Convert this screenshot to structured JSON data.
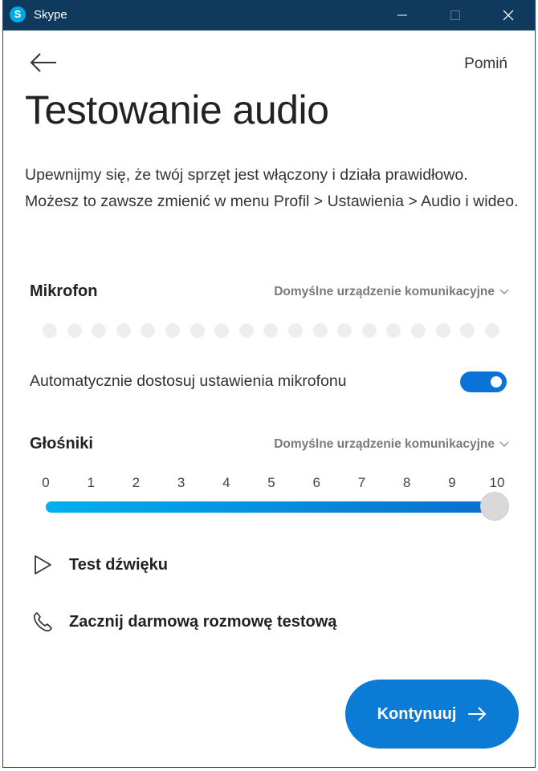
{
  "window": {
    "logo_letter": "S",
    "title": "Skype",
    "controls": [
      "minimize",
      "maximize",
      "close"
    ]
  },
  "nav": {
    "back_icon": "arrow-left-icon",
    "skip_label": "Pomiń"
  },
  "page": {
    "title": "Testowanie audio",
    "description": "Upewnijmy się, że twój sprzęt jest włączony i działa prawidłowo. Możesz to zawsze zmienić w menu Profil > Ustawienia > Audio i wideo."
  },
  "microphone": {
    "label": "Mikrofon",
    "device": "Domyślne urządzenie komunikacyjne",
    "level_dots_total": 19,
    "level_dots_active": 0,
    "auto_adjust_label": "Automatycznie dostosuj ustawienia mikrofonu",
    "auto_adjust_on": true
  },
  "speakers": {
    "label": "Głośniki",
    "device": "Domyślne urządzenie komunikacyjne",
    "scale": [
      "0",
      "1",
      "2",
      "3",
      "4",
      "5",
      "6",
      "7",
      "8",
      "9",
      "10"
    ],
    "volume": 10,
    "volume_max": 10
  },
  "actions": {
    "test_sound_label": "Test dźwięku",
    "test_call_label": "Zacznij darmową rozmowę testową"
  },
  "footer": {
    "continue_label": "Kontynuuj"
  },
  "colors": {
    "titlebar": "#0f3a5e",
    "accent": "#0b7bd6",
    "slider_start": "#00b0ee",
    "slider_end": "#0b6ecd"
  }
}
